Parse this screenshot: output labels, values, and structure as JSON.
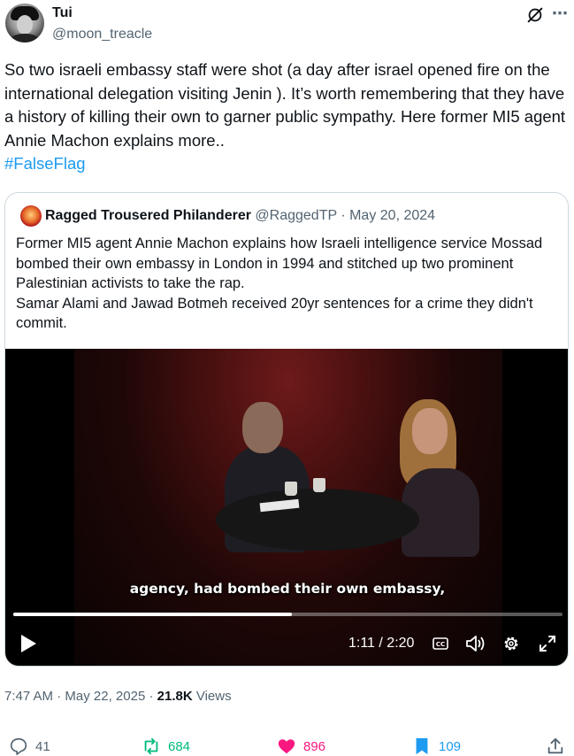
{
  "author": {
    "name": "Tui",
    "handle": "@moon_treacle"
  },
  "tweet": {
    "text": "So two israeli embassy staff were shot (a day after israel opened fire on the international delegation visiting Jenin ). It’s worth remembering that they have a history of killing their own to garner public sympathy. Here former MI5 agent Annie Machon explains more..",
    "hashtag": "#FalseFlag"
  },
  "quote": {
    "name": "Ragged Trousered Philanderer",
    "handle": "@RaggedTP",
    "separator": "·",
    "date": "May 20, 2024",
    "text_line1": "Former MI5 agent Annie Machon explains how Israeli intelligence service Mossad bombed their own embassy in London in 1994 and stitched up two prominent Palestinian activists to take the rap.",
    "text_line2": "Samar Alami and Jawad Botmeh received 20yr sentences for a crime they didn't commit."
  },
  "video": {
    "subtitle": "agency, had bombed their own embassy,",
    "time": "1:11 / 2:20",
    "progress_fraction": 0.508
  },
  "meta": {
    "time": "7:47 AM",
    "sep1": "·",
    "date": "May 22, 2025",
    "sep2": "·",
    "views_count": "21.8K",
    "views_label": "Views"
  },
  "actions": {
    "replies": "41",
    "reposts": "684",
    "likes": "896",
    "bookmarks": "109"
  },
  "colors": {
    "link": "#1d9bf0",
    "repost": "#00ba7c",
    "like": "#f91880",
    "bookmark": "#1d9bf0",
    "muted": "#536471"
  },
  "icons": {
    "more": "⋯"
  }
}
